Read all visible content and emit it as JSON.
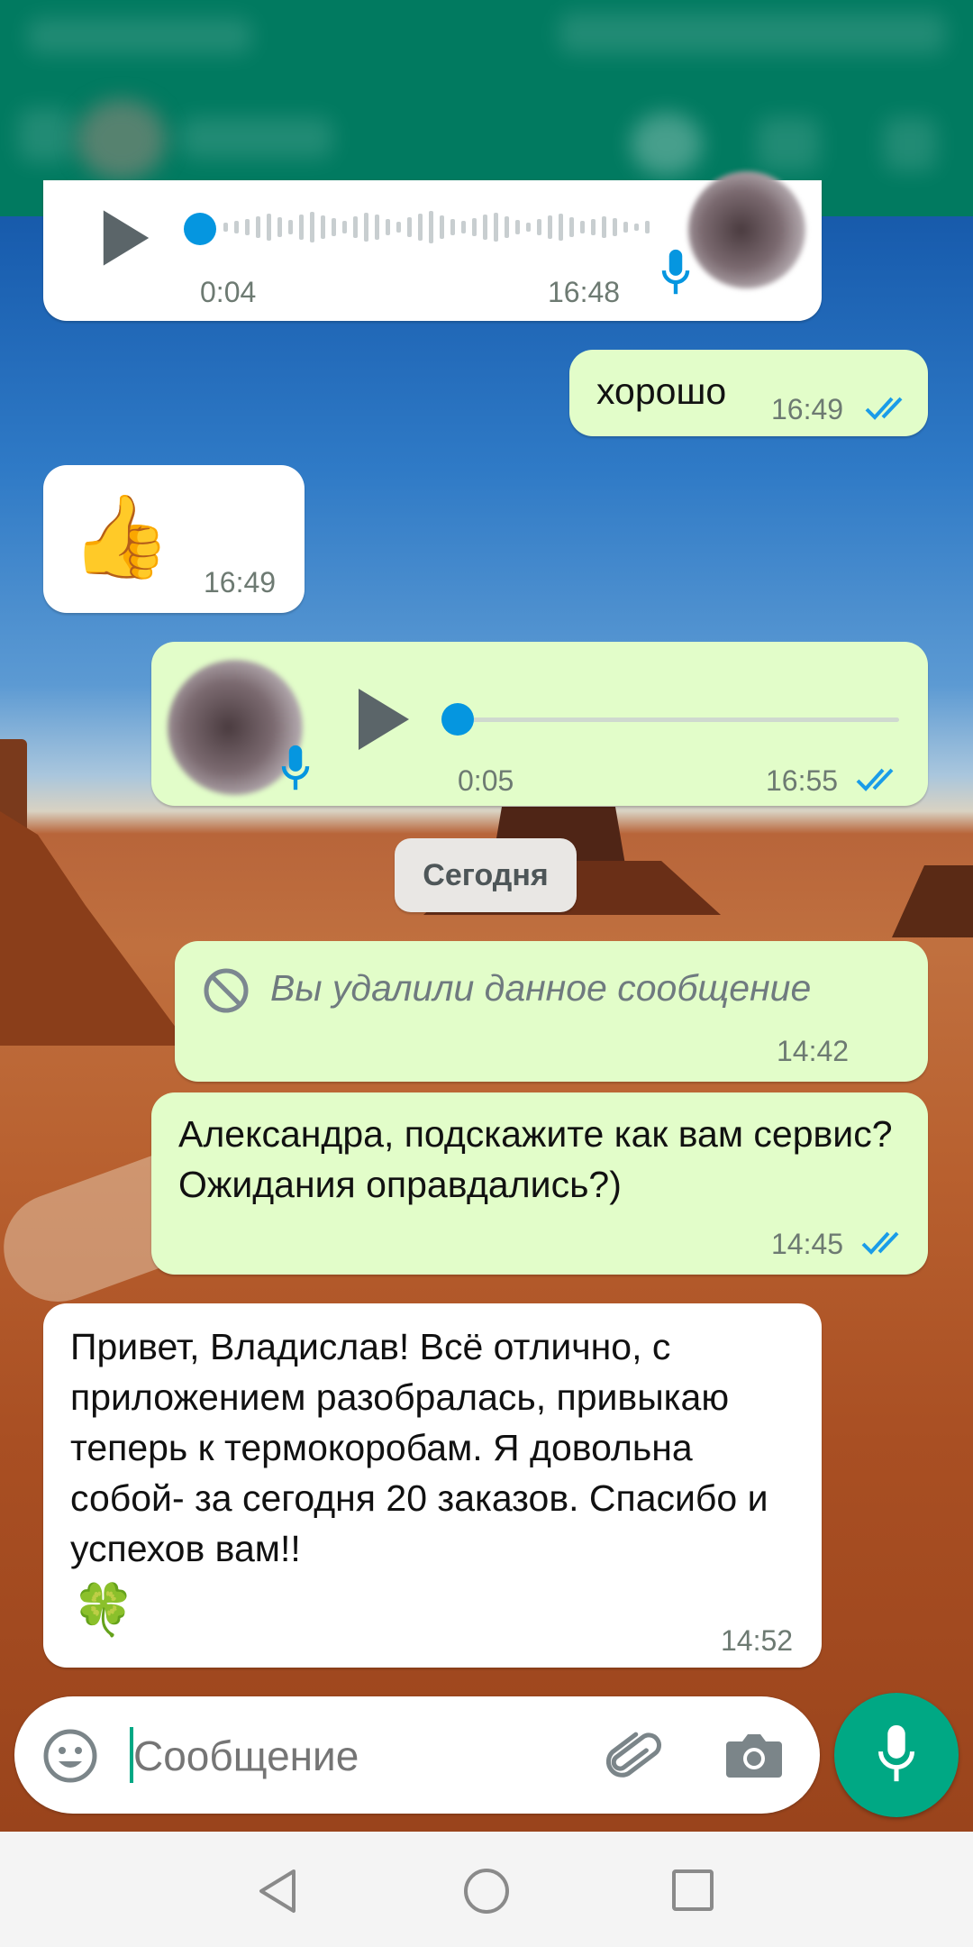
{
  "colors": {
    "header": "#017a60",
    "outgoing_bubble": "#e2fdc9",
    "incoming_bubble": "#ffffff",
    "read_ticks": "#1a9ce8",
    "mic_fab": "#00a884"
  },
  "messages": [
    {
      "direction": "in",
      "type": "voice",
      "duration": "0:04",
      "time": "16:48"
    },
    {
      "direction": "out",
      "type": "text",
      "text": "хорошо",
      "time": "16:49",
      "status": "read"
    },
    {
      "direction": "in",
      "type": "emoji",
      "text": "👍",
      "time": "16:49"
    },
    {
      "direction": "out",
      "type": "voice",
      "duration": "0:05",
      "time": "16:55",
      "status": "read"
    },
    {
      "direction": "out",
      "type": "deleted",
      "text": "Вы удалили данное сообщение",
      "time": "14:42"
    },
    {
      "direction": "out",
      "type": "text",
      "text": "Александра, подскажите как вам сервис? Ожидания оправдались?)",
      "time": "14:45",
      "status": "read"
    },
    {
      "direction": "in",
      "type": "text",
      "text": "Привет, Владислав! Всё отлично, с приложением разобралась, привыкаю теперь к термокоробам. Я довольна собой- за сегодня 20 заказов. Спасибо и успехов вам!!",
      "emoji": "🍀",
      "time": "14:52"
    }
  ],
  "date_separator": "Сегодня",
  "composer": {
    "placeholder": "Сообщение",
    "emoji_icon": "smiley-icon",
    "attach_icon": "paperclip-icon",
    "camera_icon": "camera-icon",
    "send_icon": "microphone-icon"
  },
  "navbar": {
    "back_icon": "triangle-back-icon",
    "home_icon": "circle-home-icon",
    "recents_icon": "square-recents-icon"
  }
}
